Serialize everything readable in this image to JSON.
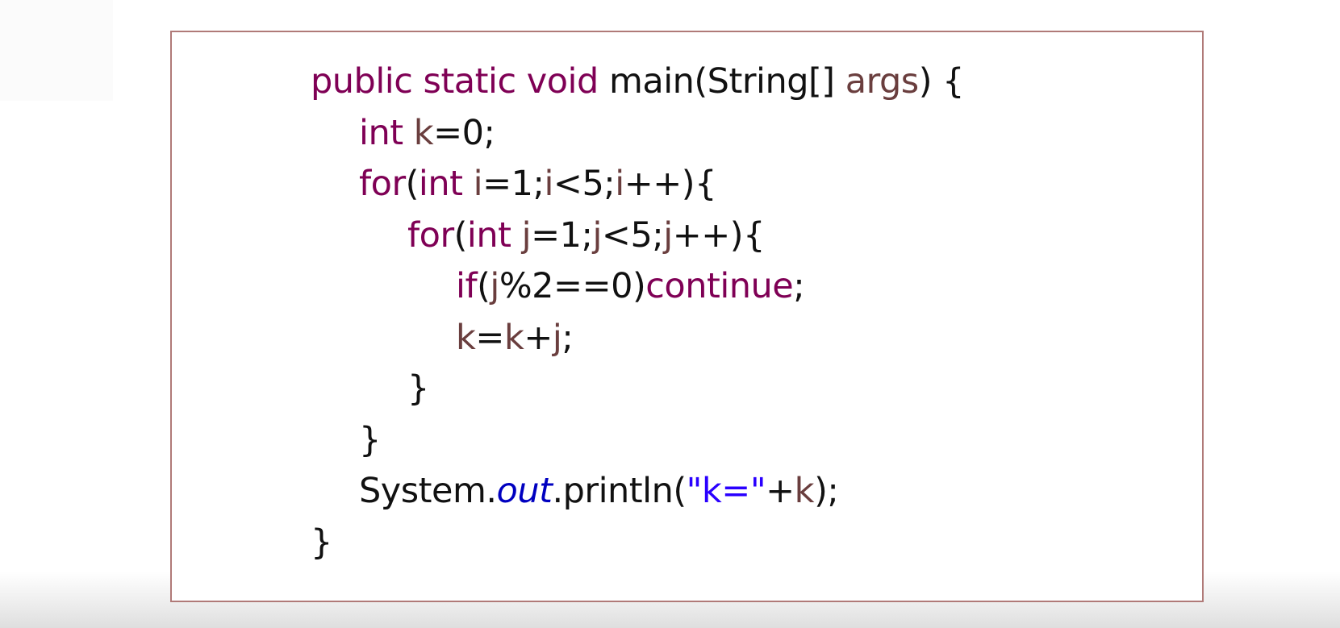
{
  "colors": {
    "keyword": "#7f0055",
    "variable": "#6a3e3e",
    "plain": "#111111",
    "field": "#0000c0",
    "string": "#2a00ff",
    "box_border": "#b07a78"
  },
  "code": {
    "lines": [
      {
        "indent": 0,
        "tokens": [
          {
            "t": "kw",
            "v": "public static void "
          },
          {
            "t": "plain",
            "v": "main(String[] "
          },
          {
            "t": "var",
            "v": "args"
          },
          {
            "t": "plain",
            "v": ") {"
          }
        ]
      },
      {
        "indent": 1,
        "tokens": [
          {
            "t": "kw",
            "v": "int "
          },
          {
            "t": "var",
            "v": "k"
          },
          {
            "t": "plain",
            "v": "=0;"
          }
        ]
      },
      {
        "indent": 1,
        "tokens": [
          {
            "t": "kw",
            "v": "for"
          },
          {
            "t": "plain",
            "v": "("
          },
          {
            "t": "kw",
            "v": "int "
          },
          {
            "t": "var",
            "v": "i"
          },
          {
            "t": "plain",
            "v": "=1;"
          },
          {
            "t": "var",
            "v": "i"
          },
          {
            "t": "plain",
            "v": "<5;"
          },
          {
            "t": "var",
            "v": "i"
          },
          {
            "t": "plain",
            "v": "++){"
          }
        ]
      },
      {
        "indent": 2,
        "tokens": [
          {
            "t": "kw",
            "v": "for"
          },
          {
            "t": "plain",
            "v": "("
          },
          {
            "t": "kw",
            "v": "int "
          },
          {
            "t": "var",
            "v": "j"
          },
          {
            "t": "plain",
            "v": "=1;"
          },
          {
            "t": "var",
            "v": "j"
          },
          {
            "t": "plain",
            "v": "<5;"
          },
          {
            "t": "var",
            "v": "j"
          },
          {
            "t": "plain",
            "v": "++){"
          }
        ]
      },
      {
        "indent": 3,
        "tokens": [
          {
            "t": "kw",
            "v": "if"
          },
          {
            "t": "plain",
            "v": "("
          },
          {
            "t": "var",
            "v": "j"
          },
          {
            "t": "plain",
            "v": "%2==0)"
          },
          {
            "t": "kw",
            "v": "continue"
          },
          {
            "t": "plain",
            "v": ";"
          }
        ]
      },
      {
        "indent": 3,
        "tokens": [
          {
            "t": "var",
            "v": "k"
          },
          {
            "t": "plain",
            "v": "="
          },
          {
            "t": "var",
            "v": "k"
          },
          {
            "t": "plain",
            "v": "+"
          },
          {
            "t": "var",
            "v": "j"
          },
          {
            "t": "plain",
            "v": ";"
          }
        ]
      },
      {
        "indent": 2,
        "tokens": [
          {
            "t": "plain",
            "v": "}"
          }
        ]
      },
      {
        "indent": 1,
        "tokens": [
          {
            "t": "plain",
            "v": "}"
          }
        ]
      },
      {
        "indent": 1,
        "tokens": [
          {
            "t": "plain",
            "v": "System."
          },
          {
            "t": "field",
            "v": "out"
          },
          {
            "t": "plain",
            "v": ".println("
          },
          {
            "t": "str",
            "v": "\"k=\""
          },
          {
            "t": "plain",
            "v": "+"
          },
          {
            "t": "var",
            "v": "k"
          },
          {
            "t": "plain",
            "v": ");"
          }
        ]
      },
      {
        "indent": 0,
        "tokens": [
          {
            "t": "plain",
            "v": "}"
          }
        ]
      }
    ]
  }
}
